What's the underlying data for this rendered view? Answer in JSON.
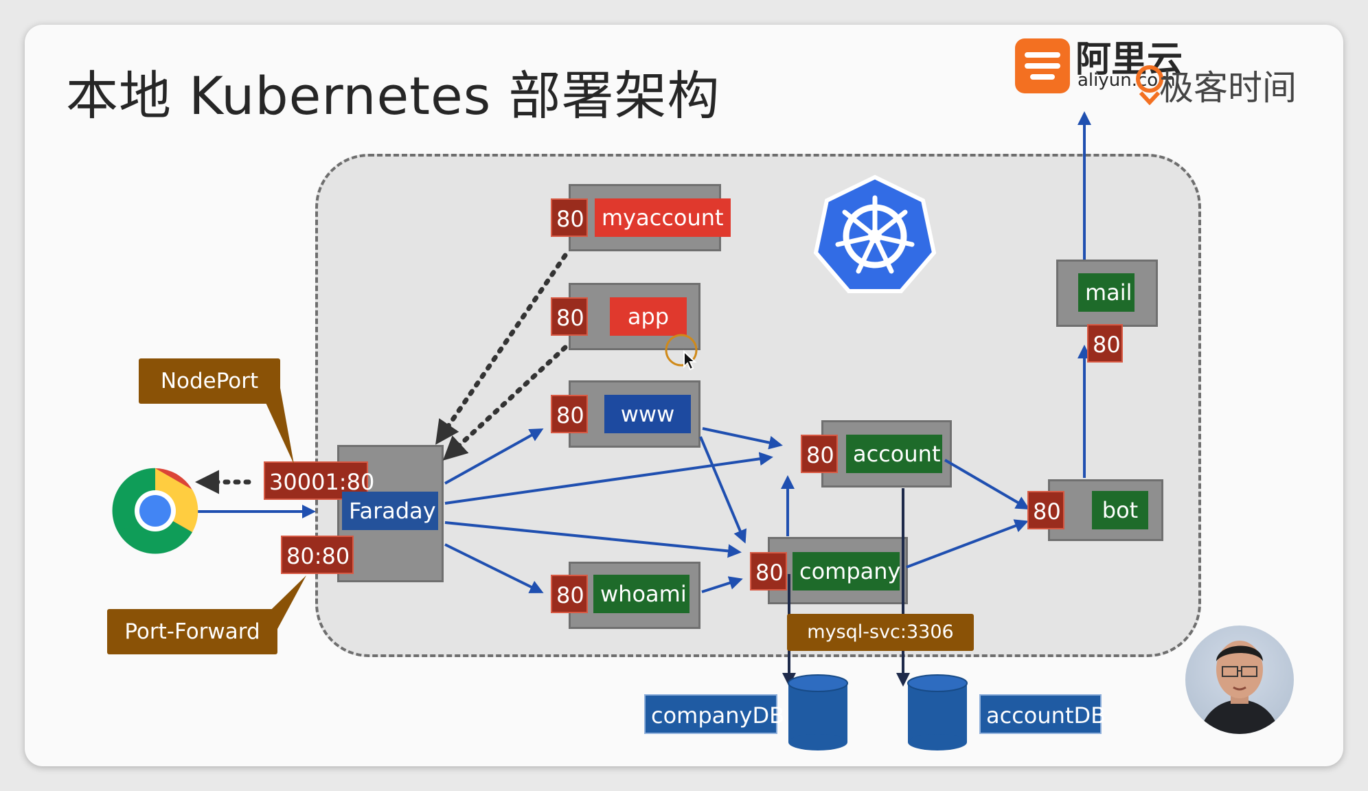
{
  "title": "本地 Kubernetes 部署架构",
  "logos": {
    "aliyun_cn": "阿里云",
    "aliyun_en": "aliyun.com",
    "geektime": "极客时间"
  },
  "callouts": {
    "nodeport": "NodePort",
    "port_forward": "Port-Forward",
    "mysql_svc": "mysql-svc:3306"
  },
  "ingress": {
    "name": "Faraday",
    "nodeport_mapping": "30001:80",
    "forward_mapping": "80:80"
  },
  "services": [
    {
      "name": "myaccount",
      "port": "80",
      "color": "#e0392d"
    },
    {
      "name": "app",
      "port": "80",
      "color": "#e0392d"
    },
    {
      "name": "www",
      "port": "80",
      "color": "#1d4aa0"
    },
    {
      "name": "whoami",
      "port": "80",
      "color": "#1e6b2a"
    },
    {
      "name": "account",
      "port": "80",
      "color": "#1e6b2a"
    },
    {
      "name": "company",
      "port": "80",
      "color": "#1e6b2a"
    },
    {
      "name": "bot",
      "port": "80",
      "color": "#1e6b2a"
    },
    {
      "name": "mail",
      "port": "80",
      "color": "#1e6b2a"
    }
  ],
  "databases": [
    "companyDB",
    "accountDB"
  ],
  "icons": [
    "chrome-browser-icon",
    "kubernetes-logo-icon",
    "aliyun-logo-icon",
    "geektime-logo-icon",
    "mouse-cursor-icon",
    "presenter-avatar"
  ]
}
